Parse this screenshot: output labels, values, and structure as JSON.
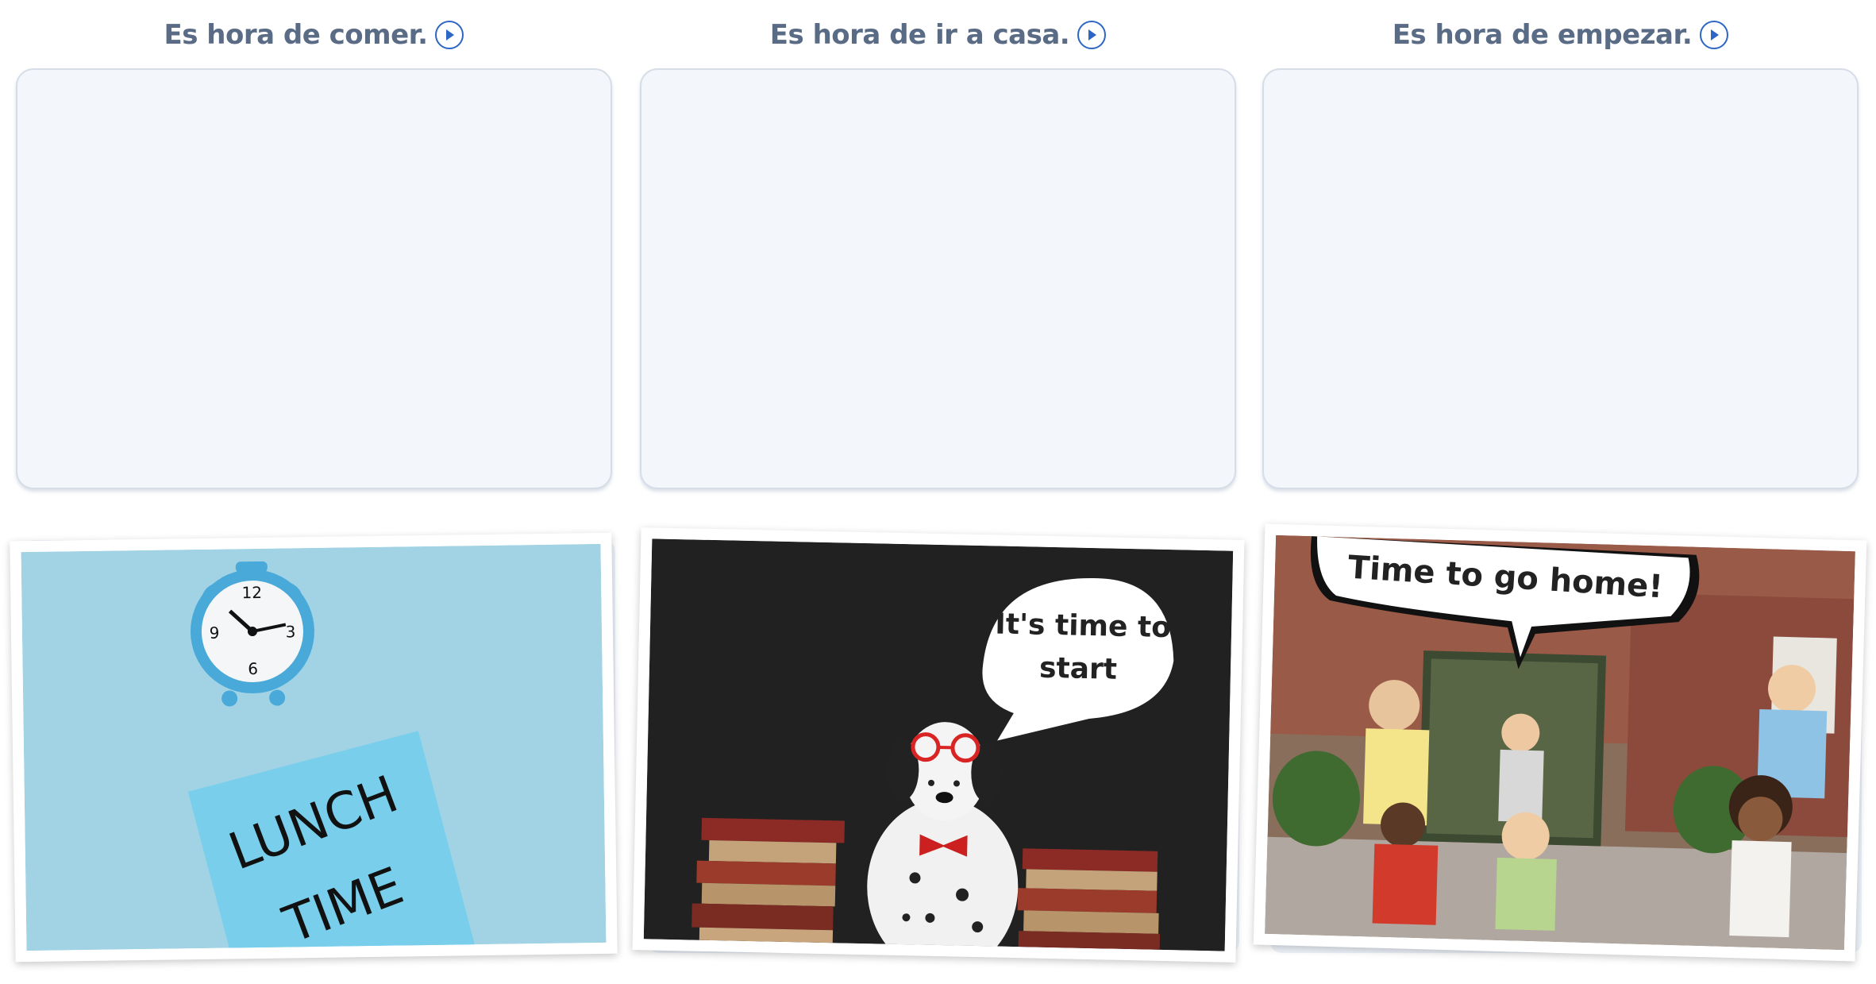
{
  "columns": [
    {
      "label": "Es hora de comer."
    },
    {
      "label": "Es hora de ir a casa."
    },
    {
      "label": "Es hora de empezar."
    }
  ],
  "cards": [
    {
      "note_line1": "LUNCH",
      "note_line2": "TIME",
      "clock_numbers": [
        "12",
        "3",
        "6",
        "9"
      ]
    },
    {
      "bubble_line1": "It's time to",
      "bubble_line2": "start"
    },
    {
      "bubble_text": "Time to go home!"
    }
  ],
  "colors": {
    "heading": "#5a6b85",
    "play_icon": "#2d66c4",
    "drop_fill": "#f3f6fb",
    "drop_border": "#d7dde7"
  }
}
